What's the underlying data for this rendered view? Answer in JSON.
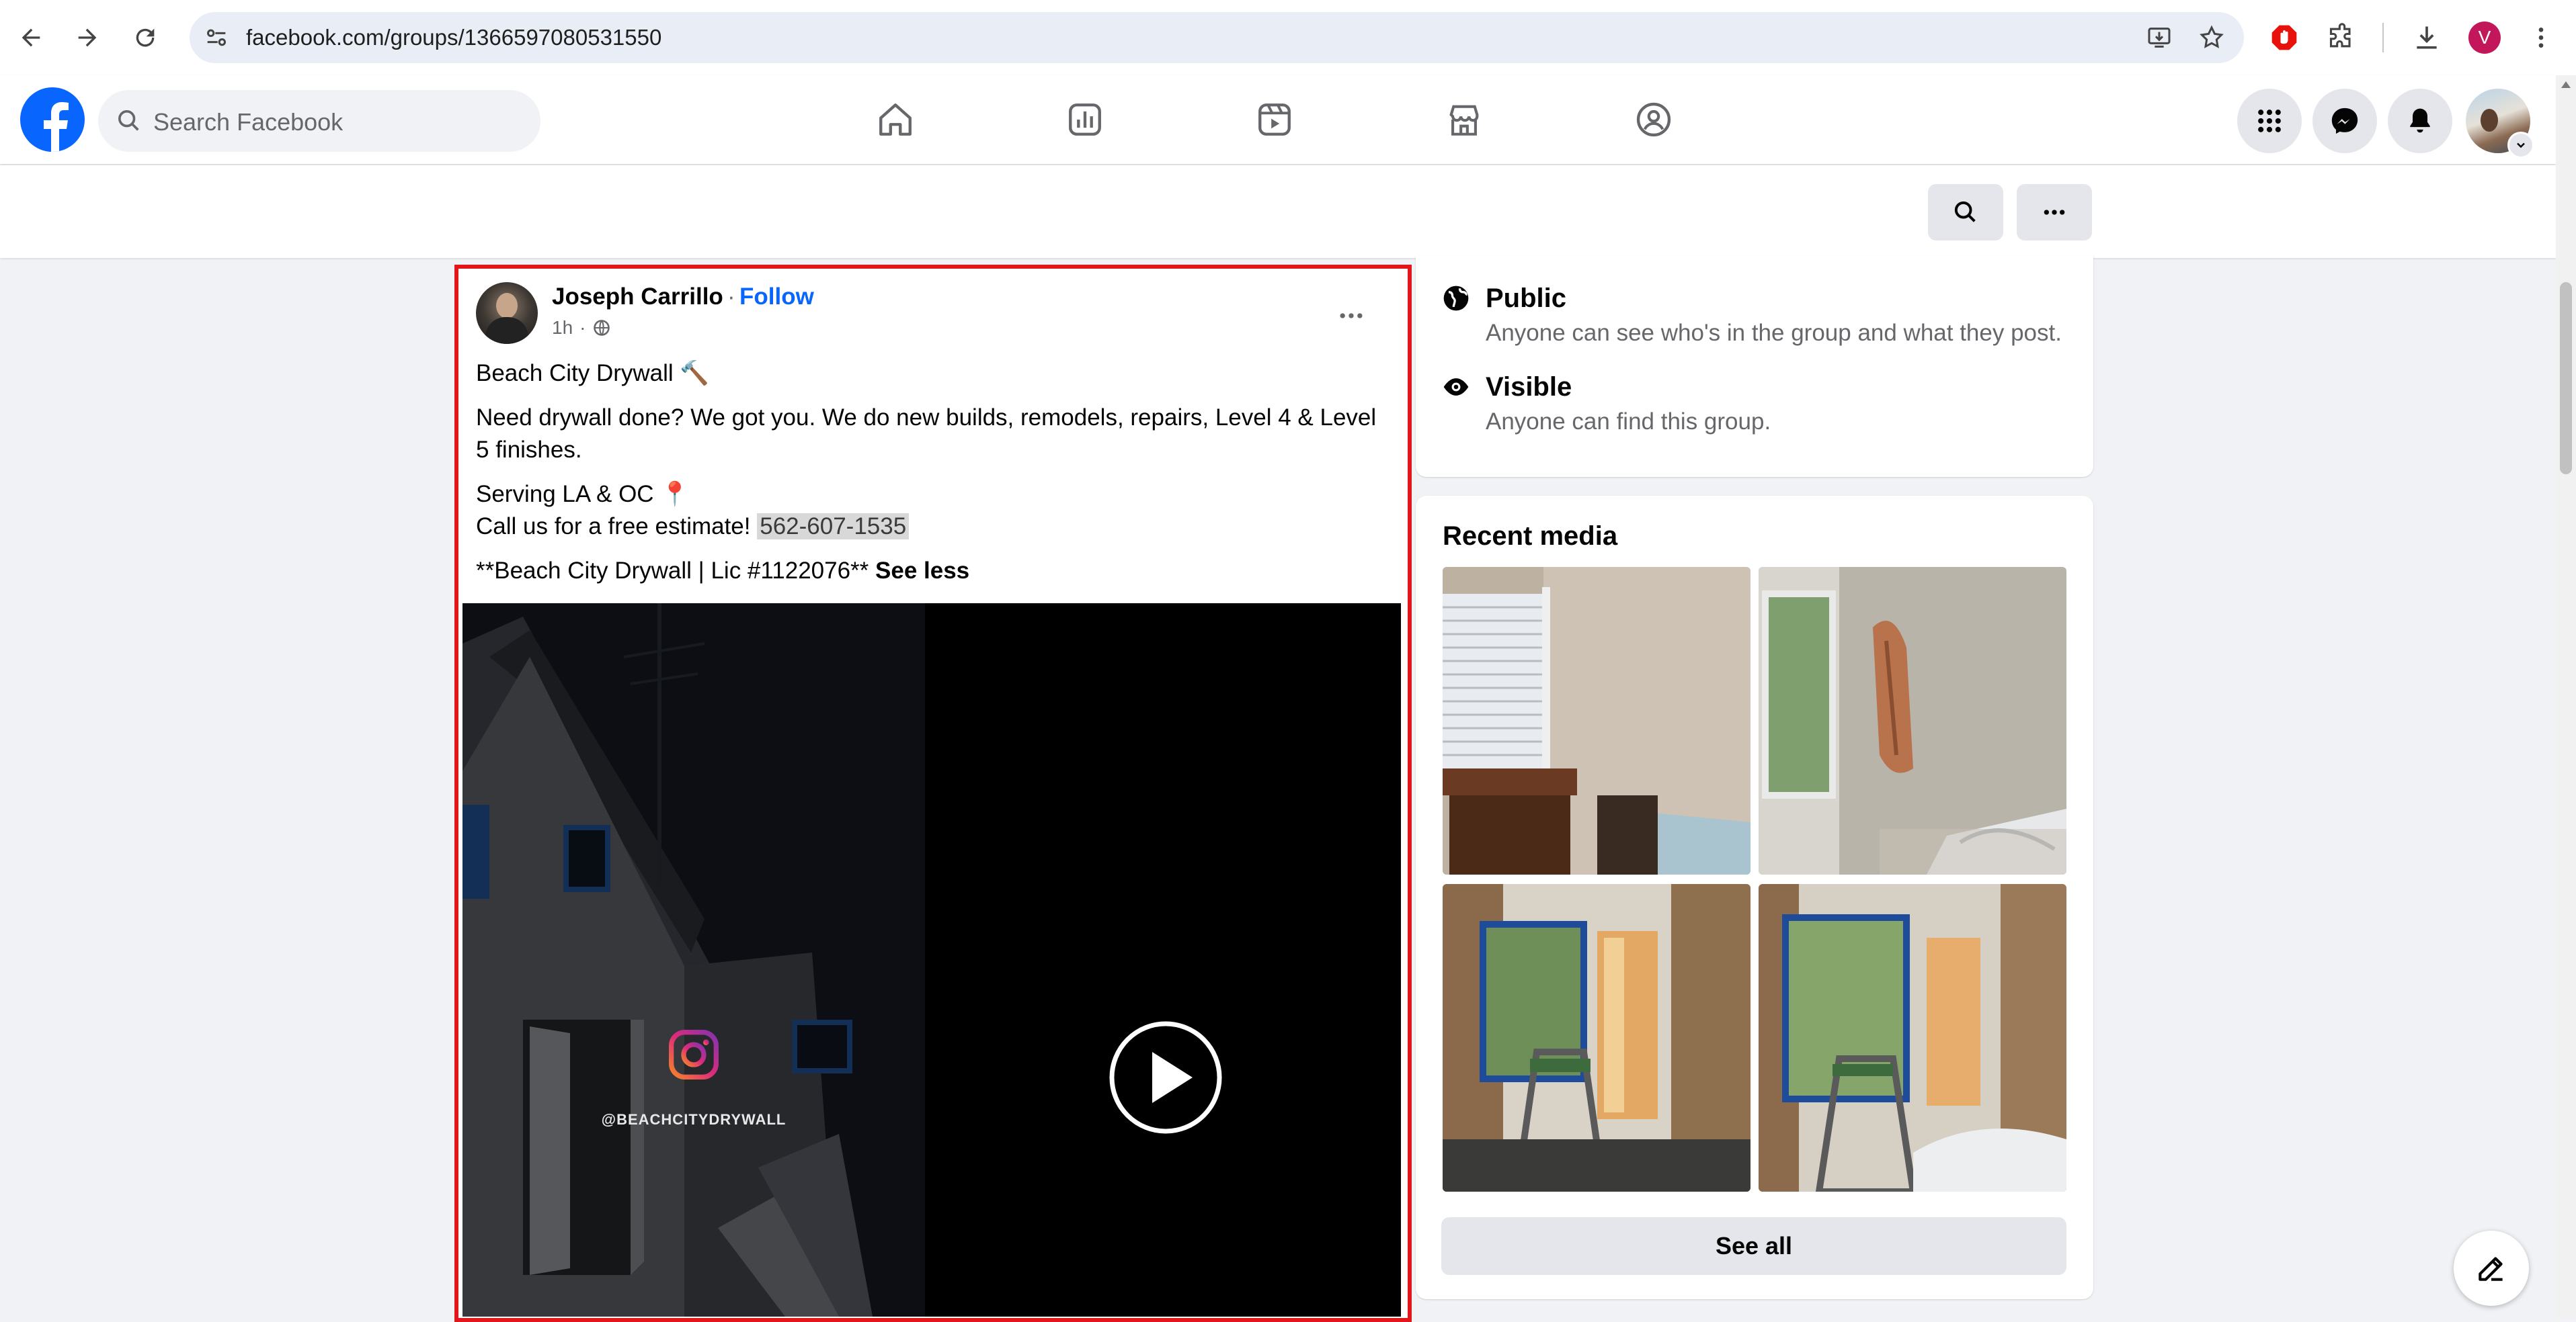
{
  "browser": {
    "url": "facebook.com/groups/1366597080531550",
    "profile_initial": "V"
  },
  "header": {
    "search_placeholder": "Search Facebook"
  },
  "post": {
    "author": "Joseph Carrillo",
    "separator": "·",
    "follow_label": "Follow",
    "time": "1h",
    "lines": [
      "Beach City Drywall 🔨",
      "Need drywall done? We got you. We do new builds, remodels, repairs, Level 4 & Level",
      "5 finishes.",
      "Serving LA & OC 📍",
      "Call us for a free estimate! ",
      "**Beach City Drywall | Lic #1122076** "
    ],
    "phone": "562-607-1535",
    "see_less": "See less",
    "instagram_handle": "@BEACHCITYDRYWALL"
  },
  "about": {
    "privacy_title": "Public",
    "privacy_desc": "Anyone can see who's in the group and what they post.",
    "visibility_title": "Visible",
    "visibility_desc": "Anyone can find this group."
  },
  "recent_media": {
    "title": "Recent media",
    "see_all": "See all"
  },
  "colors": {
    "facebook_blue": "#0866ff",
    "highlight_red": "#e2161b",
    "page_bg": "#f0f2f5"
  }
}
